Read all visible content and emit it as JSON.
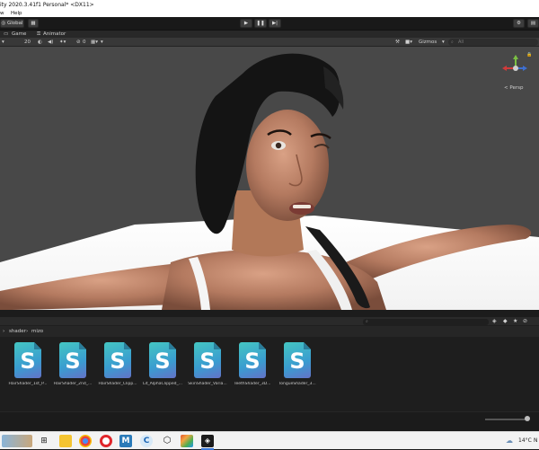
{
  "window": {
    "title": "ity 2020.3.41f1 Personal* <DX11>"
  },
  "menu": {
    "items": [
      "w",
      "Help"
    ]
  },
  "toolbar": {
    "global_label": "Global"
  },
  "tabs": {
    "game": "Game",
    "animator": "Animator"
  },
  "scene_toolbar": {
    "value_20": "20",
    "gizmos": "Gizmos",
    "search_placeholder": "All",
    "zero": "0"
  },
  "scene_gizmo": {
    "persp_label": "< Persp"
  },
  "breadcrumb": {
    "shader": "shader",
    "sep": "›",
    "current": "mizo"
  },
  "assets": [
    {
      "name": "HairShader_1st_P..."
    },
    {
      "name": "HairShader_2nd_..."
    },
    {
      "name": "HairShader_Clipp..."
    },
    {
      "name": "Lit_AlphaClipped_..."
    },
    {
      "name": "SkinShader_Varia..."
    },
    {
      "name": "TeethShader_3D..."
    },
    {
      "name": "TongueShader_3..."
    }
  ],
  "asset_icon_letter": "S",
  "taskbar": {
    "temp": "14°C",
    "lang": "N"
  },
  "colors": {
    "viewport_bg": "#484848",
    "editor_dark": "#1e1e1e",
    "icon_teal": "#44c6c2",
    "icon_blue": "#3a9cd0",
    "icon_purple": "#6472c8"
  }
}
